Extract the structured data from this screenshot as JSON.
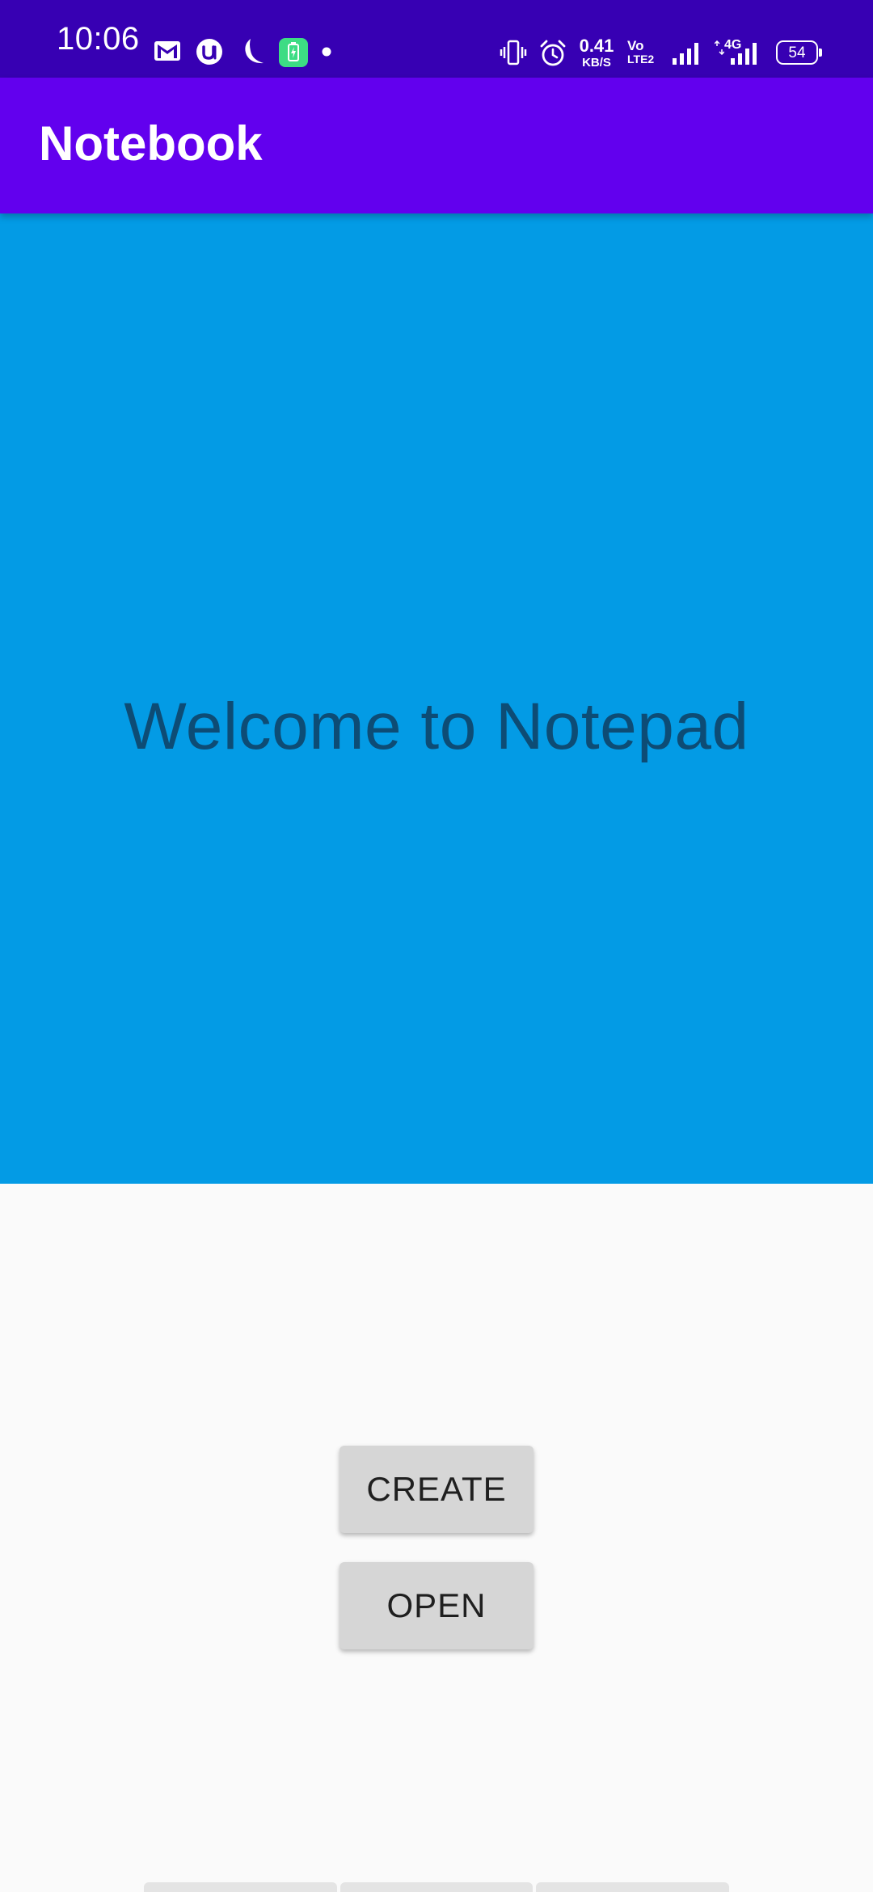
{
  "status_bar": {
    "time": "10:06",
    "net_speed_value": "0.41",
    "net_speed_unit": "KB/S",
    "volte_top": "Vo",
    "volte_bottom": "LTE2",
    "network_type": "4G",
    "battery_level": "54",
    "icons": [
      "gmail-icon",
      "u-app-icon",
      "moon-icon",
      "battery-saver-icon",
      "dot-icon",
      "vibrate-icon",
      "alarm-icon",
      "signal-icon",
      "signal-icon"
    ]
  },
  "app_bar": {
    "title": "Notebook"
  },
  "banner": {
    "text": "Welcome to Notepad"
  },
  "actions": {
    "create_label": "CREATE",
    "open_label": "OPEN"
  },
  "colors": {
    "status_bar": "#3700b3",
    "app_bar": "#6200ee",
    "banner": "#039be5",
    "banner_text": "#0d4c75",
    "button": "#d6d6d6",
    "background": "#fafafa"
  }
}
